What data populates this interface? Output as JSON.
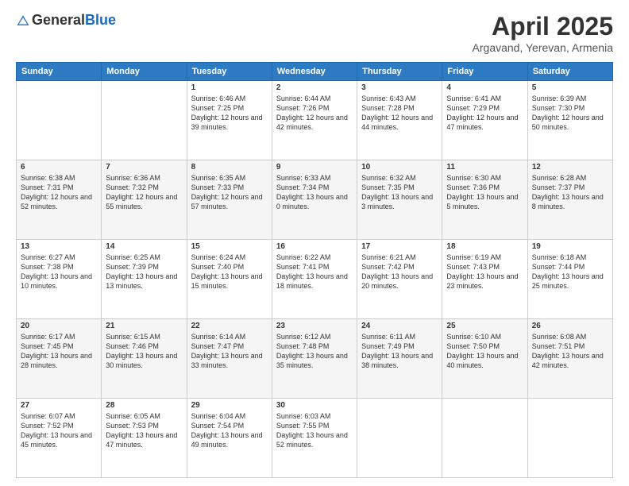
{
  "header": {
    "logo_general": "General",
    "logo_blue": "Blue",
    "title": "April 2025",
    "subtitle": "Argavand, Yerevan, Armenia"
  },
  "calendar": {
    "days_of_week": [
      "Sunday",
      "Monday",
      "Tuesday",
      "Wednesday",
      "Thursday",
      "Friday",
      "Saturday"
    ],
    "weeks": [
      [
        {
          "day": "",
          "sunrise": "",
          "sunset": "",
          "daylight": ""
        },
        {
          "day": "",
          "sunrise": "",
          "sunset": "",
          "daylight": ""
        },
        {
          "day": "1",
          "sunrise": "Sunrise: 6:46 AM",
          "sunset": "Sunset: 7:25 PM",
          "daylight": "Daylight: 12 hours and 39 minutes."
        },
        {
          "day": "2",
          "sunrise": "Sunrise: 6:44 AM",
          "sunset": "Sunset: 7:26 PM",
          "daylight": "Daylight: 12 hours and 42 minutes."
        },
        {
          "day": "3",
          "sunrise": "Sunrise: 6:43 AM",
          "sunset": "Sunset: 7:28 PM",
          "daylight": "Daylight: 12 hours and 44 minutes."
        },
        {
          "day": "4",
          "sunrise": "Sunrise: 6:41 AM",
          "sunset": "Sunset: 7:29 PM",
          "daylight": "Daylight: 12 hours and 47 minutes."
        },
        {
          "day": "5",
          "sunrise": "Sunrise: 6:39 AM",
          "sunset": "Sunset: 7:30 PM",
          "daylight": "Daylight: 12 hours and 50 minutes."
        }
      ],
      [
        {
          "day": "6",
          "sunrise": "Sunrise: 6:38 AM",
          "sunset": "Sunset: 7:31 PM",
          "daylight": "Daylight: 12 hours and 52 minutes."
        },
        {
          "day": "7",
          "sunrise": "Sunrise: 6:36 AM",
          "sunset": "Sunset: 7:32 PM",
          "daylight": "Daylight: 12 hours and 55 minutes."
        },
        {
          "day": "8",
          "sunrise": "Sunrise: 6:35 AM",
          "sunset": "Sunset: 7:33 PM",
          "daylight": "Daylight: 12 hours and 57 minutes."
        },
        {
          "day": "9",
          "sunrise": "Sunrise: 6:33 AM",
          "sunset": "Sunset: 7:34 PM",
          "daylight": "Daylight: 13 hours and 0 minutes."
        },
        {
          "day": "10",
          "sunrise": "Sunrise: 6:32 AM",
          "sunset": "Sunset: 7:35 PM",
          "daylight": "Daylight: 13 hours and 3 minutes."
        },
        {
          "day": "11",
          "sunrise": "Sunrise: 6:30 AM",
          "sunset": "Sunset: 7:36 PM",
          "daylight": "Daylight: 13 hours and 5 minutes."
        },
        {
          "day": "12",
          "sunrise": "Sunrise: 6:28 AM",
          "sunset": "Sunset: 7:37 PM",
          "daylight": "Daylight: 13 hours and 8 minutes."
        }
      ],
      [
        {
          "day": "13",
          "sunrise": "Sunrise: 6:27 AM",
          "sunset": "Sunset: 7:38 PM",
          "daylight": "Daylight: 13 hours and 10 minutes."
        },
        {
          "day": "14",
          "sunrise": "Sunrise: 6:25 AM",
          "sunset": "Sunset: 7:39 PM",
          "daylight": "Daylight: 13 hours and 13 minutes."
        },
        {
          "day": "15",
          "sunrise": "Sunrise: 6:24 AM",
          "sunset": "Sunset: 7:40 PM",
          "daylight": "Daylight: 13 hours and 15 minutes."
        },
        {
          "day": "16",
          "sunrise": "Sunrise: 6:22 AM",
          "sunset": "Sunset: 7:41 PM",
          "daylight": "Daylight: 13 hours and 18 minutes."
        },
        {
          "day": "17",
          "sunrise": "Sunrise: 6:21 AM",
          "sunset": "Sunset: 7:42 PM",
          "daylight": "Daylight: 13 hours and 20 minutes."
        },
        {
          "day": "18",
          "sunrise": "Sunrise: 6:19 AM",
          "sunset": "Sunset: 7:43 PM",
          "daylight": "Daylight: 13 hours and 23 minutes."
        },
        {
          "day": "19",
          "sunrise": "Sunrise: 6:18 AM",
          "sunset": "Sunset: 7:44 PM",
          "daylight": "Daylight: 13 hours and 25 minutes."
        }
      ],
      [
        {
          "day": "20",
          "sunrise": "Sunrise: 6:17 AM",
          "sunset": "Sunset: 7:45 PM",
          "daylight": "Daylight: 13 hours and 28 minutes."
        },
        {
          "day": "21",
          "sunrise": "Sunrise: 6:15 AM",
          "sunset": "Sunset: 7:46 PM",
          "daylight": "Daylight: 13 hours and 30 minutes."
        },
        {
          "day": "22",
          "sunrise": "Sunrise: 6:14 AM",
          "sunset": "Sunset: 7:47 PM",
          "daylight": "Daylight: 13 hours and 33 minutes."
        },
        {
          "day": "23",
          "sunrise": "Sunrise: 6:12 AM",
          "sunset": "Sunset: 7:48 PM",
          "daylight": "Daylight: 13 hours and 35 minutes."
        },
        {
          "day": "24",
          "sunrise": "Sunrise: 6:11 AM",
          "sunset": "Sunset: 7:49 PM",
          "daylight": "Daylight: 13 hours and 38 minutes."
        },
        {
          "day": "25",
          "sunrise": "Sunrise: 6:10 AM",
          "sunset": "Sunset: 7:50 PM",
          "daylight": "Daylight: 13 hours and 40 minutes."
        },
        {
          "day": "26",
          "sunrise": "Sunrise: 6:08 AM",
          "sunset": "Sunset: 7:51 PM",
          "daylight": "Daylight: 13 hours and 42 minutes."
        }
      ],
      [
        {
          "day": "27",
          "sunrise": "Sunrise: 6:07 AM",
          "sunset": "Sunset: 7:52 PM",
          "daylight": "Daylight: 13 hours and 45 minutes."
        },
        {
          "day": "28",
          "sunrise": "Sunrise: 6:05 AM",
          "sunset": "Sunset: 7:53 PM",
          "daylight": "Daylight: 13 hours and 47 minutes."
        },
        {
          "day": "29",
          "sunrise": "Sunrise: 6:04 AM",
          "sunset": "Sunset: 7:54 PM",
          "daylight": "Daylight: 13 hours and 49 minutes."
        },
        {
          "day": "30",
          "sunrise": "Sunrise: 6:03 AM",
          "sunset": "Sunset: 7:55 PM",
          "daylight": "Daylight: 13 hours and 52 minutes."
        },
        {
          "day": "",
          "sunrise": "",
          "sunset": "",
          "daylight": ""
        },
        {
          "day": "",
          "sunrise": "",
          "sunset": "",
          "daylight": ""
        },
        {
          "day": "",
          "sunrise": "",
          "sunset": "",
          "daylight": ""
        }
      ]
    ]
  }
}
